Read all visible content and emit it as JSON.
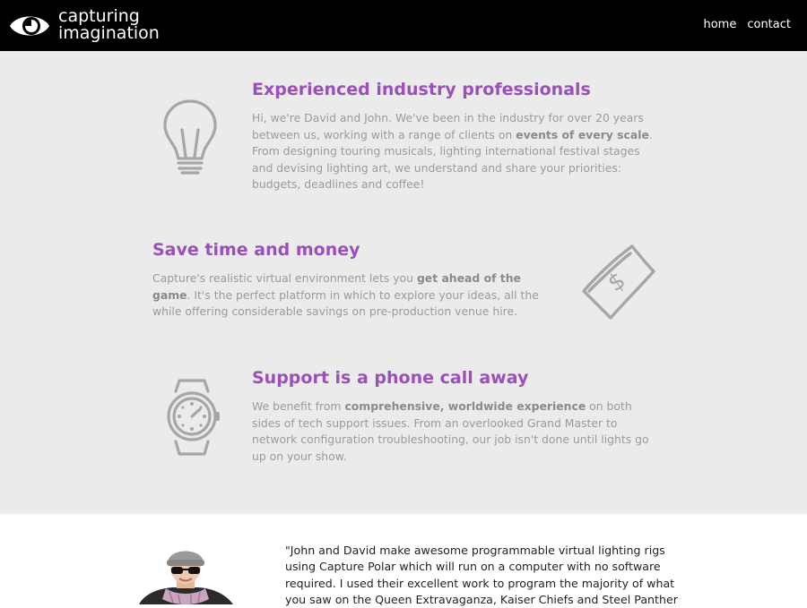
{
  "header": {
    "logo_line1": "capturing",
    "logo_line2": "imagination",
    "nav": [
      "home",
      "contact"
    ]
  },
  "features": [
    {
      "title": "Experienced industry professionals",
      "icon": "lightbulb-icon",
      "body_pre": "Hi, we're David and John. We've been in the industry for over 20 years between us, working with a range of clients on ",
      "body_bold": "events of every scale",
      "body_post": ". From designing touring musicals, lighting international festival stages and devising lighting art, we understand and share your priorities: budgets, deadlines and coffee!"
    },
    {
      "title": "Save time and money",
      "icon": "money-bill-icon",
      "body_pre": "Capture's realistic virtual environment lets you ",
      "body_bold": "get ahead of the game",
      "body_post": ". It's the perfect platform in which to explore your ideas, all the while offering considerable savings on pre-production venue hire."
    },
    {
      "title": "Support is a phone call away",
      "icon": "watch-icon",
      "body_pre": "We benefit from ",
      "body_bold": "comprehensive, worldwide experience",
      "body_post": " on both sides of tech support issues. From an overlooked Grand Master to network configuration troubleshooting, our job isn't done until lights go up on your show."
    }
  ],
  "testimonial": {
    "quote": "\"John and David make awesome programmable virtual lighting rigs using Capture Polar which will run on a computer with no software required. I used their excellent work to program the majority of what you saw on the Queen Extravaganza, Kaiser Chiefs and Steel Panther"
  },
  "colors": {
    "heading": "#9b4fbb",
    "body_text": "#9a9a9a",
    "features_bg": "#ebebeb",
    "header_bg": "#000000"
  }
}
